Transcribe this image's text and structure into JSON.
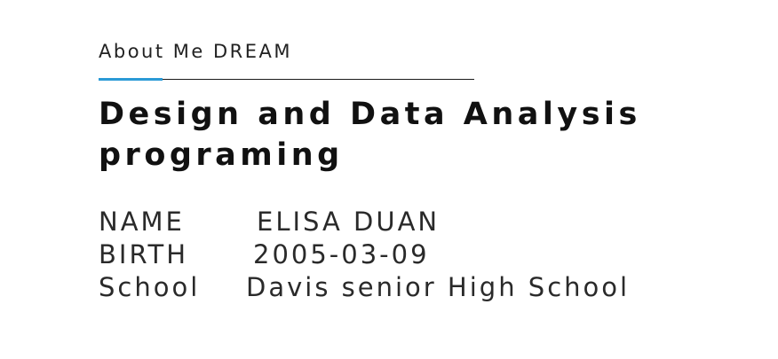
{
  "section": {
    "label": "About Me DREAM"
  },
  "headline": {
    "text": "Design and Data Analysis programing"
  },
  "info": [
    {
      "key": "NAME",
      "value": "ELISA DUAN"
    },
    {
      "key": "BIRTH",
      "value": "2005-03-09"
    },
    {
      "key": "School",
      "value": "Davis senior High School"
    }
  ],
  "colors": {
    "accent": "#2a9ad6",
    "text": "#1a1a1a",
    "background": "#ffffff"
  }
}
